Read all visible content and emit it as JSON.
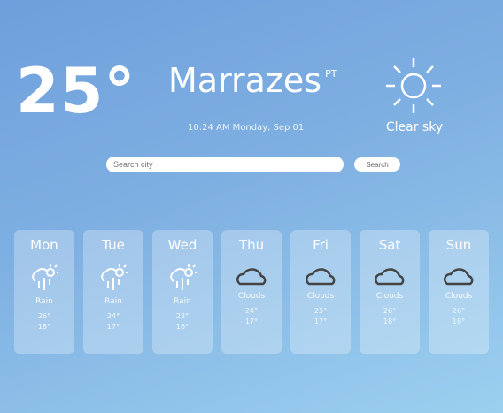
{
  "current": {
    "temperature": "25°",
    "city": "Marrazes",
    "country": "PT",
    "datetime": "10:24 AM Monday, Sep 01",
    "condition": "Clear sky",
    "icon": "sun-icon"
  },
  "search": {
    "placeholder": "Search city",
    "button": "Search"
  },
  "forecast": [
    {
      "day": "Mon",
      "condition": "Rain",
      "max": "26°",
      "min": "18°",
      "icon": "cloud-sun-rain-icon"
    },
    {
      "day": "Tue",
      "condition": "Rain",
      "max": "24°",
      "min": "17°",
      "icon": "cloud-sun-rain-icon"
    },
    {
      "day": "Wed",
      "condition": "Rain",
      "max": "23°",
      "min": "16°",
      "icon": "cloud-sun-rain-icon"
    },
    {
      "day": "Thu",
      "condition": "Clouds",
      "max": "24°",
      "min": "17°",
      "icon": "cloud-icon"
    },
    {
      "day": "Fri",
      "condition": "Clouds",
      "max": "25°",
      "min": "17°",
      "icon": "cloud-icon"
    },
    {
      "day": "Sat",
      "condition": "Clouds",
      "max": "26°",
      "min": "18°",
      "icon": "cloud-icon"
    },
    {
      "day": "Sun",
      "condition": "Clouds",
      "max": "26°",
      "min": "18°",
      "icon": "cloud-icon"
    }
  ]
}
